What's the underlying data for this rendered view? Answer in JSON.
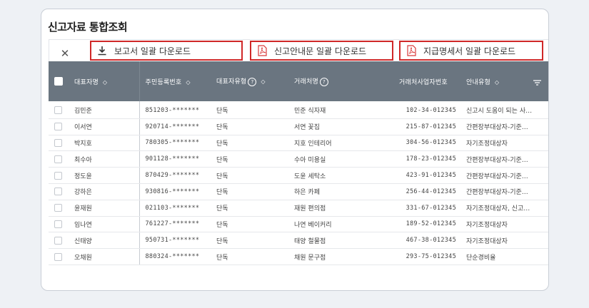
{
  "title": "신고자료 통합조회",
  "toolbar": {
    "close_symbol": "✕",
    "buttons": [
      {
        "label": "보고서 일괄 다운로드",
        "icon": "download-icon"
      },
      {
        "label": "신고안내문 일괄 다운로드",
        "icon": "pdf-icon"
      },
      {
        "label": "지급명세서 일괄 다운로드",
        "icon": "pdf-icon"
      }
    ]
  },
  "colors": {
    "header_bg": "#6a7580",
    "button_border": "#d02828",
    "pdf_red": "#d93a3a"
  },
  "table": {
    "columns": {
      "rep_name": "대표자명",
      "resident_no": "주민등록번호",
      "rep_type": "대표자유형",
      "partner": "거래처명",
      "biz_no": "거래처사업자번호",
      "notice_type": "안내유형"
    },
    "sort_symbol": "◇",
    "help_symbol": "?",
    "rows": [
      {
        "name": "김민준",
        "rrn": "851203-*******",
        "type": "단독",
        "partner": "민준 식자재",
        "biz": "102-34-012345",
        "notice": "신고시 도움이 되는 사…"
      },
      {
        "name": "이서연",
        "rrn": "920714-*******",
        "type": "단독",
        "partner": "서연 꽃집",
        "biz": "215-87-012345",
        "notice": "간편장부대상자-기준…"
      },
      {
        "name": "박지호",
        "rrn": "780305-*******",
        "type": "단독",
        "partner": "지호 인테리어",
        "biz": "304-56-012345",
        "notice": "자기조정대상자"
      },
      {
        "name": "최수아",
        "rrn": "901128-*******",
        "type": "단독",
        "partner": "수아 미용실",
        "biz": "178-23-012345",
        "notice": "간편장부대상자-기준…"
      },
      {
        "name": "정도윤",
        "rrn": "870429-*******",
        "type": "단독",
        "partner": "도윤 세탁소",
        "biz": "423-91-012345",
        "notice": "간편장부대상자-기준…"
      },
      {
        "name": "강하은",
        "rrn": "930816-*******",
        "type": "단독",
        "partner": "하은 카페",
        "biz": "256-44-012345",
        "notice": "간편장부대상자-기준…"
      },
      {
        "name": "윤재원",
        "rrn": "021103-*******",
        "type": "단독",
        "partner": "재원 편의점",
        "biz": "331-67-012345",
        "notice": "자기조정대상자, 신고…"
      },
      {
        "name": "임나연",
        "rrn": "761227-*******",
        "type": "단독",
        "partner": "나연 베이커리",
        "biz": "189-52-012345",
        "notice": "자기조정대상자"
      },
      {
        "name": "신태양",
        "rrn": "950731-*******",
        "type": "단독",
        "partner": "태양 철물점",
        "biz": "467-38-012345",
        "notice": "자기조정대상자"
      },
      {
        "name": "오채원",
        "rrn": "880324-*******",
        "type": "단독",
        "partner": "채원 문구점",
        "biz": "293-75-012345",
        "notice": "단순경비율"
      }
    ]
  }
}
